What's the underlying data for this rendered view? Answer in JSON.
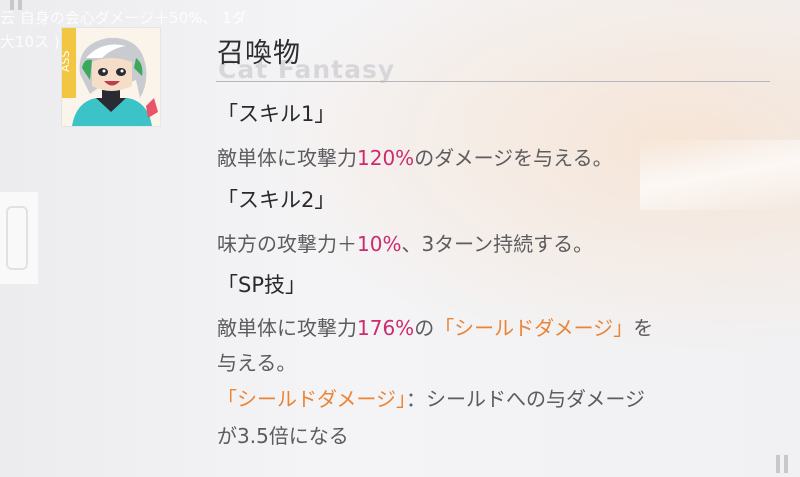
{
  "background": {
    "text_line_1": "云  自身の会心ダメージ＋50%、 1ダ",
    "text_line_2": "大10ス                  )  。",
    "watermark": "Cat Fantasy"
  },
  "panel": {
    "title": "召喚物",
    "skill1": {
      "heading": "「スキル1」",
      "desc_a": "敵単体に攻撃力",
      "desc_value": "120%",
      "desc_b": "のダメージを与える。"
    },
    "skill2": {
      "heading": "「スキル2」",
      "desc_a": "味方の攻撃力＋",
      "desc_value": "10%",
      "desc_b": "、3ターン持続する。"
    },
    "sp": {
      "heading": "「SP技」",
      "desc_a": "敵単体に攻撃力",
      "desc_value": "176%",
      "desc_b": "の",
      "desc_keyword": "「シールドダメージ」",
      "desc_c": "を",
      "desc_line2": "与える。",
      "note_keyword": "「シールドダメージ」",
      "note_a": "：シールドへの与ダメージ",
      "note_line2": "が3.5倍になる"
    }
  },
  "colors": {
    "value_pink": "#cc2c6e",
    "keyword_orange": "#ec8436",
    "heading": "#2a2a2e",
    "body_text": "#5c5c60"
  },
  "icons": {
    "portrait": "summon-character-portrait"
  }
}
